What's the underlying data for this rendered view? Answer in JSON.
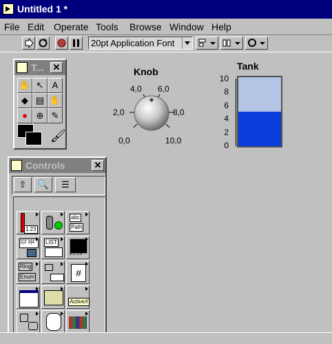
{
  "window": {
    "title": "Untitled 1 *"
  },
  "menu": [
    "File",
    "Edit",
    "Operate",
    "Tools",
    "Browse",
    "Window",
    "Help"
  ],
  "toolbar": {
    "font": "20pt Application Font"
  },
  "tools_palette": {
    "title": "T..."
  },
  "controls_palette": {
    "title": "Controls",
    "sub_labels": {
      "numeric": "1.23",
      "string": "abc",
      "path": "Path",
      "list": "LIST",
      "ring": "Ring",
      "enum": "Enum",
      "graph": "0.0 1.0",
      "activex": "ActiveX",
      "refnum": "#"
    }
  },
  "knob": {
    "label": "Knob",
    "ticks": [
      "0,0",
      "2,0",
      "4,0",
      "6,0",
      "8,0",
      "10,0"
    ],
    "value": 5
  },
  "tank": {
    "label": "Tank",
    "ticks": [
      "10",
      "8",
      "6",
      "4",
      "2",
      "0"
    ],
    "level": 5,
    "max": 10,
    "min": 0
  }
}
